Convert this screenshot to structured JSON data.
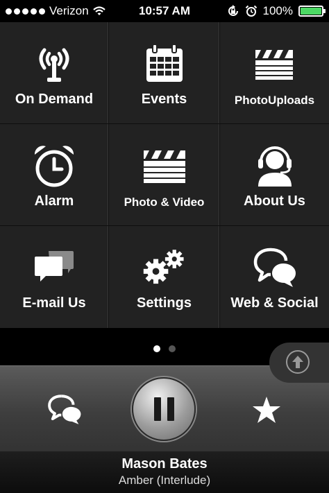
{
  "status_bar": {
    "carrier": "Verizon",
    "time": "10:57 AM",
    "battery_percent": "100%",
    "battery_level": 1.0,
    "battery_color": "#4cd964"
  },
  "grid": {
    "items": [
      {
        "label": "On Demand",
        "icon": "radio-tower-icon"
      },
      {
        "label": "Events",
        "icon": "calendar-icon"
      },
      {
        "label": "PhotoUploads",
        "icon": "clapperboard-icon"
      },
      {
        "label": "Alarm",
        "icon": "alarm-clock-icon"
      },
      {
        "label": "Photo & Video",
        "icon": "clapperboard-icon"
      },
      {
        "label": "About Us",
        "icon": "headset-user-icon"
      },
      {
        "label": "E-mail Us",
        "icon": "chat-bubbles-icon"
      },
      {
        "label": "Settings",
        "icon": "gears-icon"
      },
      {
        "label": "Web & Social",
        "icon": "speech-bubbles-icon"
      }
    ]
  },
  "pager": {
    "current": 1,
    "total": 2
  },
  "player": {
    "artist": "Mason Bates",
    "track": "Amber (Interlude)"
  }
}
